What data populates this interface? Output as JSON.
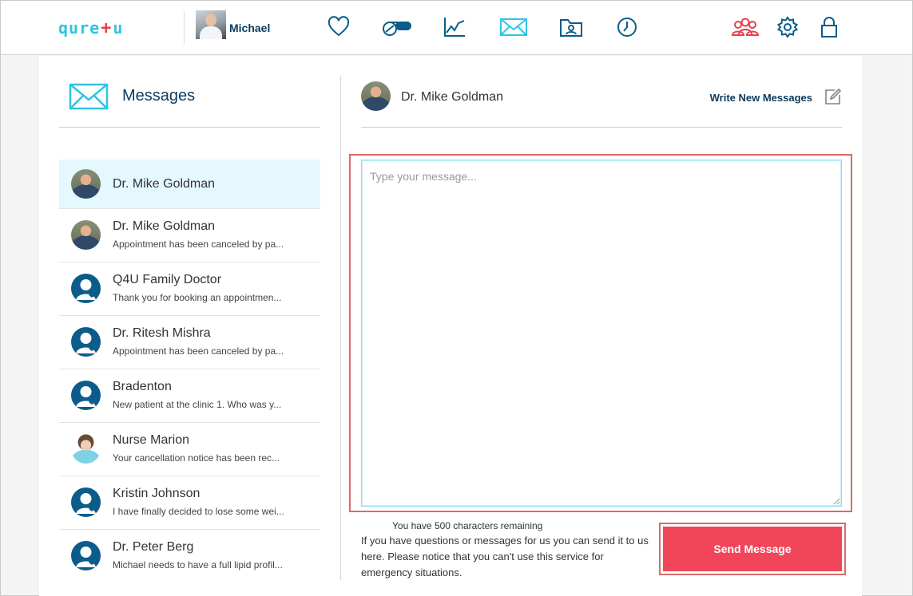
{
  "app": {
    "logo_left": "qure",
    "logo_plus": "+",
    "logo_right": "u"
  },
  "user": {
    "name": "Michael"
  },
  "nav": {
    "items": [
      "heart-icon",
      "pills-icon",
      "chart-icon",
      "mail-icon",
      "records-folder-icon",
      "clock-icon"
    ],
    "right": [
      "team-icon",
      "settings-icon",
      "lock-icon"
    ],
    "colors": {
      "primary": "#0b5c8a",
      "active": "#2ec4e6",
      "alert": "#e8404f"
    }
  },
  "messages": {
    "title": "Messages"
  },
  "conversations": [
    {
      "name": "Dr. Mike Goldman",
      "preview": "",
      "avatar": "photo"
    },
    {
      "name": "Dr. Mike Goldman",
      "preview": "Appointment has been canceled by pa...",
      "avatar": "photo"
    },
    {
      "name": "Q4U Family Doctor",
      "preview": "Thank you for booking an appointmen...",
      "avatar": "generic"
    },
    {
      "name": "Dr. Ritesh Mishra",
      "preview": "Appointment has been canceled by pa...",
      "avatar": "generic"
    },
    {
      "name": "Bradenton",
      "preview": "New patient at the clinic 1. Who was y...",
      "avatar": "generic"
    },
    {
      "name": "Nurse Marion",
      "preview": "Your cancellation notice has been rec...",
      "avatar": "nurse"
    },
    {
      "name": "Kristin Johnson",
      "preview": "I have finally decided to lose some wei...",
      "avatar": "generic"
    },
    {
      "name": "Dr. Peter Berg",
      "preview": "Michael needs to have a full lipid profil...",
      "avatar": "generic"
    }
  ],
  "chat": {
    "recipient": "Dr. Mike Goldman",
    "write_new": "Write New Messages",
    "placeholder": "Type your message...",
    "value": "",
    "chars_remaining": "You have 500 characters remaining",
    "notice": "If you have questions or messages for us you can send it to us here. Please notice that you can't use this service for emergency situations.",
    "send_label": "Send Message",
    "send_color": "#f1465a"
  }
}
